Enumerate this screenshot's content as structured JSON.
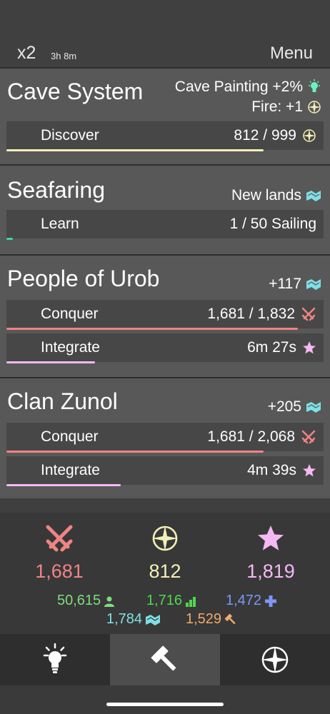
{
  "header": {
    "speed": "x2",
    "timer": "3h 8m",
    "menu_label": "Menu"
  },
  "cards": {
    "cave": {
      "title": "Cave System",
      "info1": "Cave Painting +2%",
      "info2": "Fire: +1",
      "action": {
        "label": "Discover",
        "value": "812 / 999",
        "progress": 0.81
      }
    },
    "seafaring": {
      "title": "Seafaring",
      "info1": "New lands",
      "action": {
        "label": "Learn",
        "value": "1 / 50 Sailing",
        "progress": 0.02
      }
    },
    "urob": {
      "title": "People of Urob",
      "info1": "+117",
      "conquer": {
        "label": "Conquer",
        "value": "1,681 / 1,832",
        "progress": 0.92
      },
      "integrate": {
        "label": "Integrate",
        "value": "6m 27s",
        "progress": 0.28
      }
    },
    "zunol": {
      "title": "Clan Zunol",
      "info1": "+205",
      "conquer": {
        "label": "Conquer",
        "value": "1,681 / 2,068",
        "progress": 0.81
      },
      "integrate": {
        "label": "Integrate",
        "value": "4m 39s",
        "progress": 0.36
      }
    }
  },
  "stats": {
    "military": "1,681",
    "exploration": "812",
    "culture": "1,819",
    "population": "50,615",
    "growth": "1,716",
    "health": "1,472",
    "land": "1,784",
    "production": "1,529"
  },
  "colors": {
    "military": "#f08484",
    "exploration": "#f3f0b6",
    "culture": "#f5b8f5",
    "population": "#7dde7d",
    "growth": "#4fd84f",
    "health": "#7c97f5",
    "land": "#7fe0e6",
    "production": "#f0aa6a",
    "idea": "#6ef0c0"
  },
  "nav": {
    "active": "build"
  }
}
